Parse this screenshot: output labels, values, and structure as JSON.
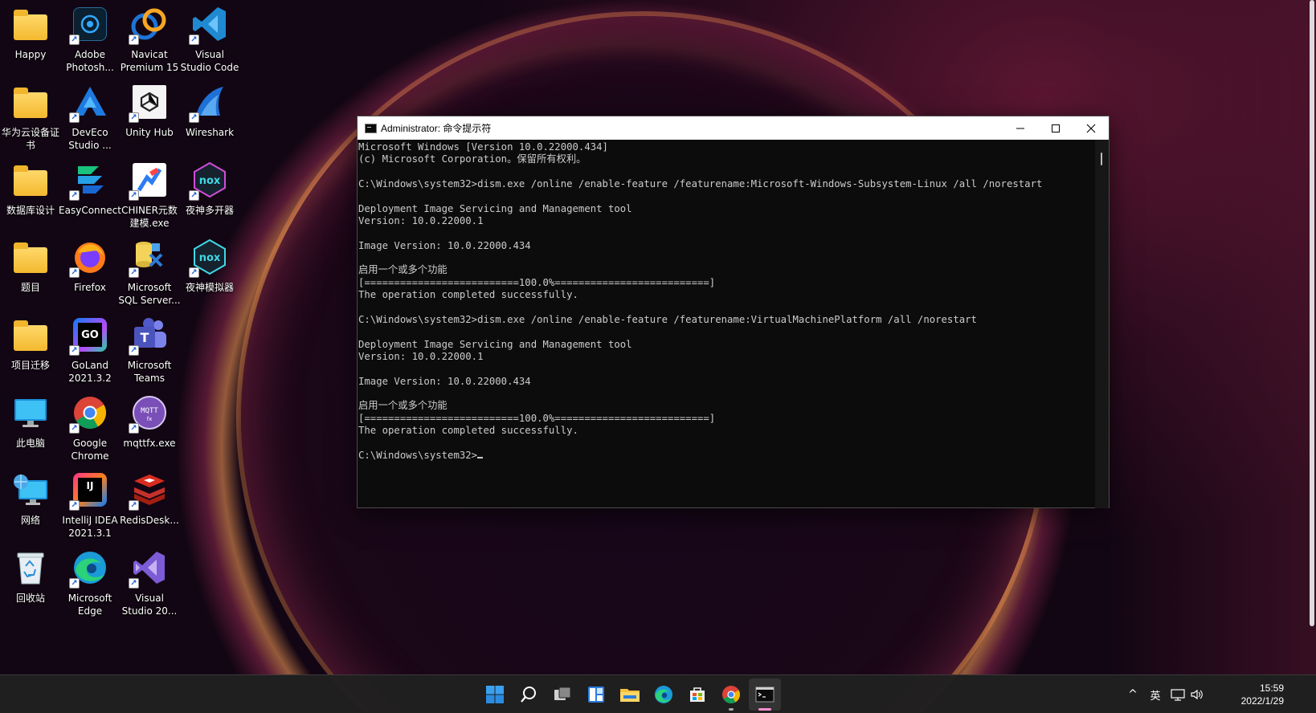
{
  "desktop": {
    "icons": [
      {
        "label": "Happy",
        "icon": "folder-icon",
        "shortcut": false
      },
      {
        "label": "Adobe\nPhotosh...",
        "icon": "photoshop-icon",
        "shortcut": true
      },
      {
        "label": "Navicat\nPremium 15",
        "icon": "navicat-icon",
        "shortcut": true
      },
      {
        "label": "Visual\nStudio Code",
        "icon": "vscode-icon",
        "shortcut": true
      },
      {
        "label": "华为云设备证\n书",
        "icon": "folder-icon",
        "shortcut": false
      },
      {
        "label": "DevEco\nStudio ...",
        "icon": "deveco-icon",
        "shortcut": true
      },
      {
        "label": "Unity Hub",
        "icon": "unity-icon",
        "shortcut": true
      },
      {
        "label": "Wireshark",
        "icon": "wireshark-icon",
        "shortcut": true
      },
      {
        "label": "数据库设计",
        "icon": "folder-icon",
        "shortcut": false
      },
      {
        "label": "EasyConnect",
        "icon": "easyconnect-icon",
        "shortcut": true
      },
      {
        "label": "CHINER元数\n建模.exe",
        "icon": "chiner-icon",
        "shortcut": true
      },
      {
        "label": "夜神多开器",
        "icon": "nox-multi-icon",
        "shortcut": true
      },
      {
        "label": "题目",
        "icon": "folder-icon",
        "shortcut": false
      },
      {
        "label": "Firefox",
        "icon": "firefox-icon",
        "shortcut": true
      },
      {
        "label": "Microsoft\nSQL Server...",
        "icon": "sqlserver-icon",
        "shortcut": true
      },
      {
        "label": "夜神模拟器",
        "icon": "nox-icon",
        "shortcut": true
      },
      {
        "label": "项目迁移",
        "icon": "folder-icon",
        "shortcut": false
      },
      {
        "label": "GoLand\n2021.3.2",
        "icon": "goland-icon",
        "shortcut": true
      },
      {
        "label": "Microsoft\nTeams",
        "icon": "teams-icon",
        "shortcut": true
      },
      {
        "label": "此电脑",
        "icon": "this-pc-icon",
        "shortcut": false
      },
      {
        "label": "Google\nChrome",
        "icon": "chrome-icon",
        "shortcut": true
      },
      {
        "label": "mqttfx.exe",
        "icon": "mqttfx-icon",
        "shortcut": true
      },
      {
        "label": "网络",
        "icon": "network-icon",
        "shortcut": false
      },
      {
        "label": "IntelliJ IDEA\n2021.3.1",
        "icon": "intellij-icon",
        "shortcut": true
      },
      {
        "label": "RedisDesk...",
        "icon": "redis-icon",
        "shortcut": true
      },
      {
        "label": "回收站",
        "icon": "recycle-bin-icon",
        "shortcut": false
      },
      {
        "label": "Microsoft\nEdge",
        "icon": "edge-icon",
        "shortcut": true
      },
      {
        "label": "Visual\nStudio 20...",
        "icon": "visual-studio-icon",
        "shortcut": true
      }
    ]
  },
  "cmd": {
    "title": "Administrator: 命令提示符",
    "lines": [
      "Microsoft Windows [Version 10.0.22000.434]",
      "(c) Microsoft Corporation。保留所有权利。",
      "",
      "C:\\Windows\\system32>dism.exe /online /enable-feature /featurename:Microsoft-Windows-Subsystem-Linux /all /norestart",
      "",
      "Deployment Image Servicing and Management tool",
      "Version: 10.0.22000.1",
      "",
      "Image Version: 10.0.22000.434",
      "",
      "启用一个或多个功能",
      "[==========================100.0%==========================]",
      "The operation completed successfully.",
      "",
      "C:\\Windows\\system32>dism.exe /online /enable-feature /featurename:VirtualMachinePlatform /all /norestart",
      "",
      "Deployment Image Servicing and Management tool",
      "Version: 10.0.22000.1",
      "",
      "Image Version: 10.0.22000.434",
      "",
      "启用一个或多个功能",
      "[==========================100.0%==========================]",
      "The operation completed successfully.",
      "",
      "C:\\Windows\\system32>"
    ],
    "minimize_icon": "minimize-icon",
    "maximize_icon": "maximize-icon",
    "close_icon": "close-icon"
  },
  "taskbar": {
    "apps": [
      {
        "name": "start",
        "icon": "windows-start-icon",
        "running": false
      },
      {
        "name": "search",
        "icon": "search-icon",
        "running": false
      },
      {
        "name": "task-view",
        "icon": "task-view-icon",
        "running": false
      },
      {
        "name": "widgets",
        "icon": "widgets-icon",
        "running": false
      },
      {
        "name": "file-explorer",
        "icon": "file-explorer-icon",
        "running": false
      },
      {
        "name": "edge",
        "icon": "edge-icon",
        "running": false
      },
      {
        "name": "store",
        "icon": "store-icon",
        "running": false
      },
      {
        "name": "chrome",
        "icon": "chrome-icon",
        "running": true
      },
      {
        "name": "terminal",
        "icon": "terminal-icon",
        "running": true,
        "active": true
      }
    ],
    "tray": {
      "chevron": "^",
      "ime": "英",
      "network_icon": "network-tray-icon",
      "volume_icon": "volume-icon",
      "time": "15:59",
      "date": "2022/1/29"
    }
  },
  "colors": {
    "console_bg": "#0c0c0c",
    "console_text": "#cccccc",
    "taskbar_bg": "#202020",
    "accent": "#0078d4"
  }
}
